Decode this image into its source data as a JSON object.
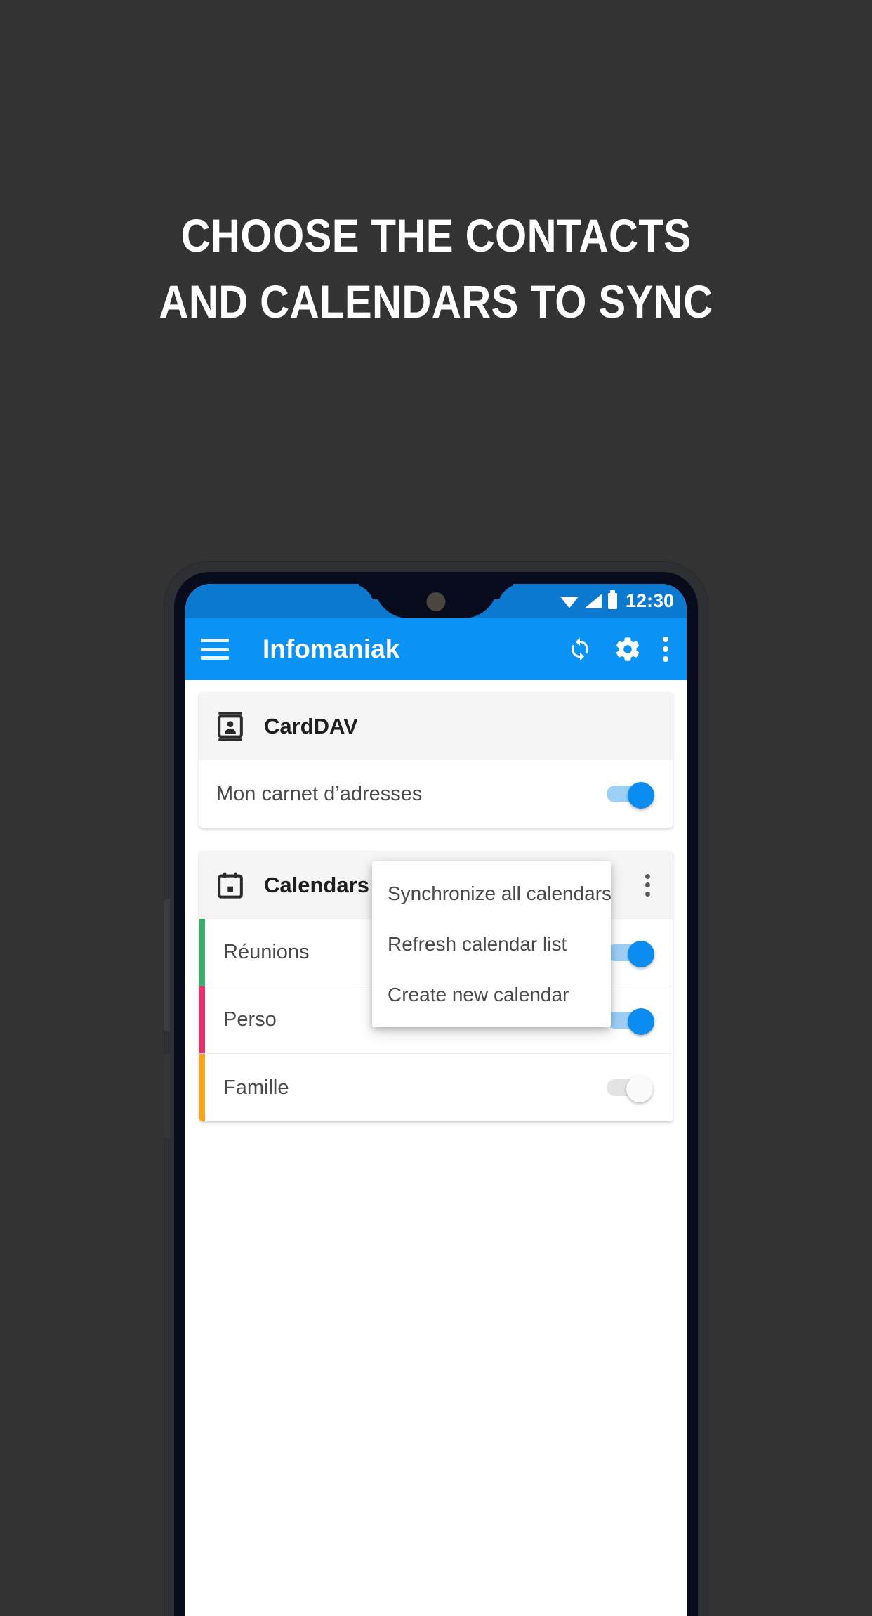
{
  "promo": {
    "headline_line1": "CHOOSE THE CONTACTS",
    "headline_line2": "AND CALENDARS TO SYNC",
    "background_color": "#333333",
    "headline_color": "#FFFFFF"
  },
  "phone": {
    "frame_color": "#2E3034",
    "bezel_color": "#070B1C"
  },
  "statusbar": {
    "time": "12:30",
    "wifi_icon": "wifi-icon",
    "signal_icon": "signal-icon",
    "battery_icon": "battery-icon",
    "background_color": "#0B79D0"
  },
  "appbar": {
    "title": "Infomaniak",
    "menu_icon": "hamburger-menu-icon",
    "sync_icon": "sync-refresh-icon",
    "settings_icon": "gear-icon",
    "overflow_icon": "kebab-menu-icon",
    "background_color": "#0A93F5",
    "title_color": "#FFFFFF"
  },
  "carddav_card": {
    "icon": "contact-card-icon",
    "title": "CardDAV",
    "rows": [
      {
        "label": "Mon carnet d’adresses",
        "enabled": true
      }
    ]
  },
  "calendars_card": {
    "icon": "calendar-icon",
    "title": "Calendars",
    "overflow_icon": "kebab-menu-icon",
    "rows": [
      {
        "label": "Réunions",
        "color": "#3AAD6F",
        "enabled": true
      },
      {
        "label": "Perso",
        "color": "#E8316E",
        "enabled": true
      },
      {
        "label": "Famille",
        "color": "#F9A51A",
        "enabled": false
      }
    ]
  },
  "popup_menu": {
    "items": [
      "Synchronize all calendars",
      "Refresh calendar list",
      "Create new calendar"
    ],
    "text_color": "#4A4A4A",
    "background_color": "#FFFFFF"
  },
  "toggle_colors": {
    "on_track": "#9ED0F7",
    "on_thumb": "#0A8CF0",
    "off_track": "#E3E3E3",
    "off_thumb": "#FAFAFA"
  }
}
